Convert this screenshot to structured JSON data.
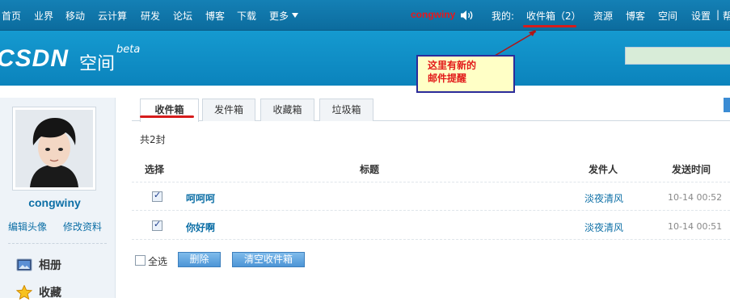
{
  "topnav": {
    "items": [
      "首页",
      "业界",
      "移动",
      "云计算",
      "研发",
      "论坛",
      "博客",
      "下载",
      "更多"
    ],
    "username": "congwiny",
    "mine_label": "我的:",
    "inbox_label": "收件箱（2）",
    "right_items": [
      "资源",
      "博客",
      "空间",
      "设置",
      "|",
      "帮"
    ],
    "speaker_icon": "speaker-icon"
  },
  "banner": {
    "logo_text": "CSDN",
    "logo_cn": "空间",
    "beta": "beta"
  },
  "callout": {
    "line1": "这里有新的",
    "line2": "邮件提醒"
  },
  "sidebar": {
    "username": "congwiny",
    "edit_avatar": "编辑头像",
    "edit_profile": "修改资料",
    "menu": [
      {
        "label": "相册",
        "icon": "photo-album-icon"
      },
      {
        "label": "收藏",
        "icon": "star-icon"
      }
    ]
  },
  "tabs": [
    "收件箱",
    "发件箱",
    "收藏箱",
    "垃圾箱"
  ],
  "active_tab": "收件箱",
  "count_text": "共2封",
  "table": {
    "headers": [
      "选择",
      "标题",
      "发件人",
      "发送时间"
    ],
    "rows": [
      {
        "checked": true,
        "title": "呵呵呵",
        "sender": "淡夜清风",
        "time": "10-14 00:52"
      },
      {
        "checked": true,
        "title": "你好啊",
        "sender": "淡夜清风",
        "time": "10-14 00:51"
      }
    ]
  },
  "actions": {
    "select_all": "全选",
    "delete": "删除",
    "clear_inbox": "清空收件箱"
  },
  "colors": {
    "nav_blue": "#0c6c9e",
    "link_blue": "#0d6fa6",
    "highlight_red": "#d61c1c",
    "callout_bg": "#ffffc6"
  }
}
